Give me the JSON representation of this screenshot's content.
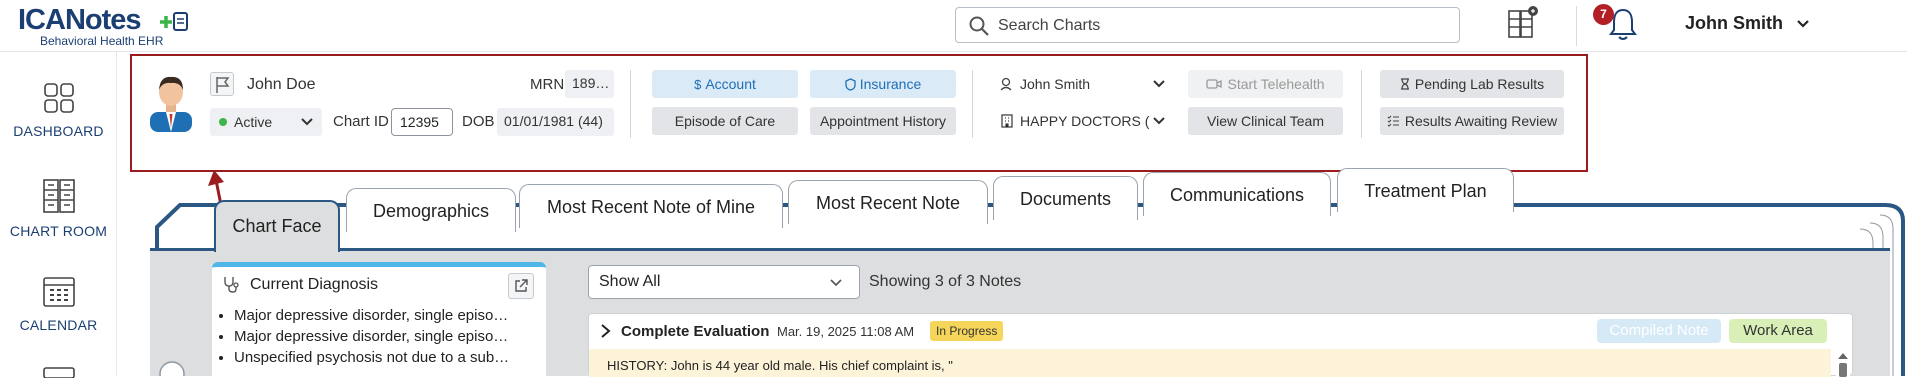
{
  "header": {
    "logo_text": "ICANotes",
    "logo_subtitle": "Behavioral Health EHR",
    "search_placeholder": "Search Charts",
    "notification_count": "7",
    "user_name": "John Smith"
  },
  "sidebar": {
    "items": [
      {
        "label": "DASHBOARD",
        "icon": "dashboard-icon"
      },
      {
        "label": "CHART ROOM",
        "icon": "chart-room-icon"
      },
      {
        "label": "CALENDAR",
        "icon": "calendar-icon"
      }
    ]
  },
  "patient": {
    "name": "John Doe",
    "mrn_label": "MRN",
    "mrn_value": "189…",
    "status": "Active",
    "chart_id_label": "Chart ID",
    "chart_id_value": "12395",
    "dob_label": "DOB",
    "dob_value": "01/01/1981 (44)"
  },
  "banner_buttons": {
    "account": "Account",
    "insurance": "Insurance",
    "episode_of_care": "Episode of Care",
    "appointment_history": "Appointment History",
    "provider": "John Smith",
    "practice": "HAPPY DOCTORS (",
    "start_telehealth": "Start Telehealth",
    "view_clinical_team": "View Clinical Team",
    "pending_lab_results": "Pending Lab Results",
    "results_awaiting_review": "Results Awaiting Review"
  },
  "tabs": [
    "Chart Face",
    "Demographics",
    "Most Recent Note of Mine",
    "Most Recent Note",
    "Documents",
    "Communications",
    "Treatment Plan"
  ],
  "diagnosis": {
    "title": "Current Diagnosis",
    "items": [
      "Major depressive disorder, single episo…",
      "Major depressive disorder, single episo…",
      "Unspecified psychosis not due to a sub…"
    ]
  },
  "notes": {
    "filter_value": "Show All",
    "count_text": "Showing 3 of 3 Notes",
    "first": {
      "title": "Complete Evaluation",
      "date": "Mar. 19, 2025 11:08 AM",
      "status": "In Progress",
      "compiled_label": "Compiled Note",
      "work_area_label": "Work Area",
      "history_text": "HISTORY: John is 44 year old male. His chief complaint is, \""
    }
  },
  "colors": {
    "brand_navy": "#1b3f73",
    "highlight_border": "#9b1c1f",
    "badge_red": "#b21f24",
    "account_blue": "#1f6fb5",
    "status_green": "#3bb54a"
  }
}
